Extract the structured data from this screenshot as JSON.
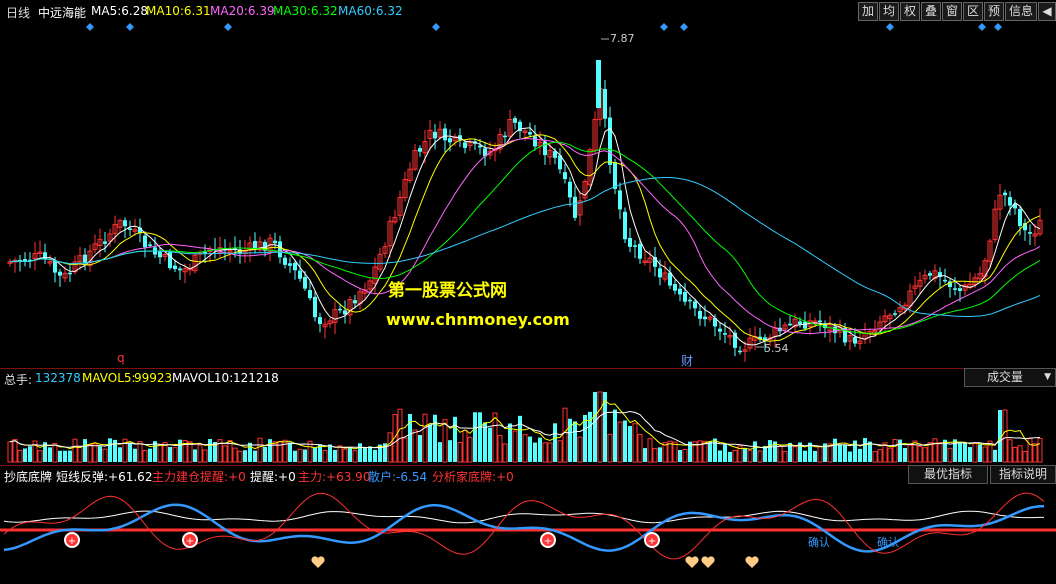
{
  "header": {
    "period": "日线",
    "stock_name": "中远海能",
    "ma": [
      {
        "label": "MA5:",
        "value": "6.28",
        "color": "#ffffff"
      },
      {
        "label": "MA10:",
        "value": "6.31",
        "color": "#ffff00"
      },
      {
        "label": "MA20:",
        "value": "6.39",
        "color": "#ff66ff"
      },
      {
        "label": "MA30:",
        "value": "6.32",
        "color": "#00ff00"
      },
      {
        "label": "MA60:",
        "value": "6.32",
        "color": "#33ccff"
      }
    ],
    "tools": [
      "加",
      "均",
      "权",
      "叠",
      "窗",
      "区",
      "预",
      "信息"
    ],
    "collapse_glyph": "◀"
  },
  "main_chart": {
    "high_label": "7.87",
    "low_label": "5.54",
    "marker_q": "q",
    "marker_cai": "财",
    "watermark_cn": "第一股票公式网",
    "watermark_url": "www.chnmoney.com",
    "price_range": [
      5.2,
      8.0
    ]
  },
  "volume_panel": {
    "total_label": "总手:",
    "total_value": "132378",
    "mavol5_label": "MAVOL5:",
    "mavol5_value": "99923",
    "mavol10_label": "MAVOL10:",
    "mavol10_value": "121218",
    "dropdown": "成交量"
  },
  "indicator_panel": {
    "name": "抄底底牌",
    "items": [
      {
        "label": "短线反弹:",
        "value": "+61.62",
        "color": "#ffffff"
      },
      {
        "label": "主力建仓提醒:",
        "value": "+0",
        "color": "#ff3333"
      },
      {
        "label": "提醒:",
        "value": "+0",
        "color": "#ffffff"
      },
      {
        "label": "主力:",
        "value": "+63.90",
        "color": "#ff3333"
      },
      {
        "label": "散户:",
        "value": "-6.54",
        "color": "#3399ff"
      },
      {
        "label": "分析家底牌:",
        "value": "+0",
        "color": "#ff3333"
      }
    ],
    "btn_best": "最优指标",
    "btn_help": "指标说明",
    "confirm_labels": [
      "确认",
      "确认"
    ]
  },
  "colors": {
    "up": "#ff3232",
    "down": "#54ffff",
    "ma5": "#ffffff",
    "ma10": "#ffff00",
    "ma20": "#ff66ff",
    "ma30": "#00ff00",
    "ma60": "#33ccff"
  }
}
